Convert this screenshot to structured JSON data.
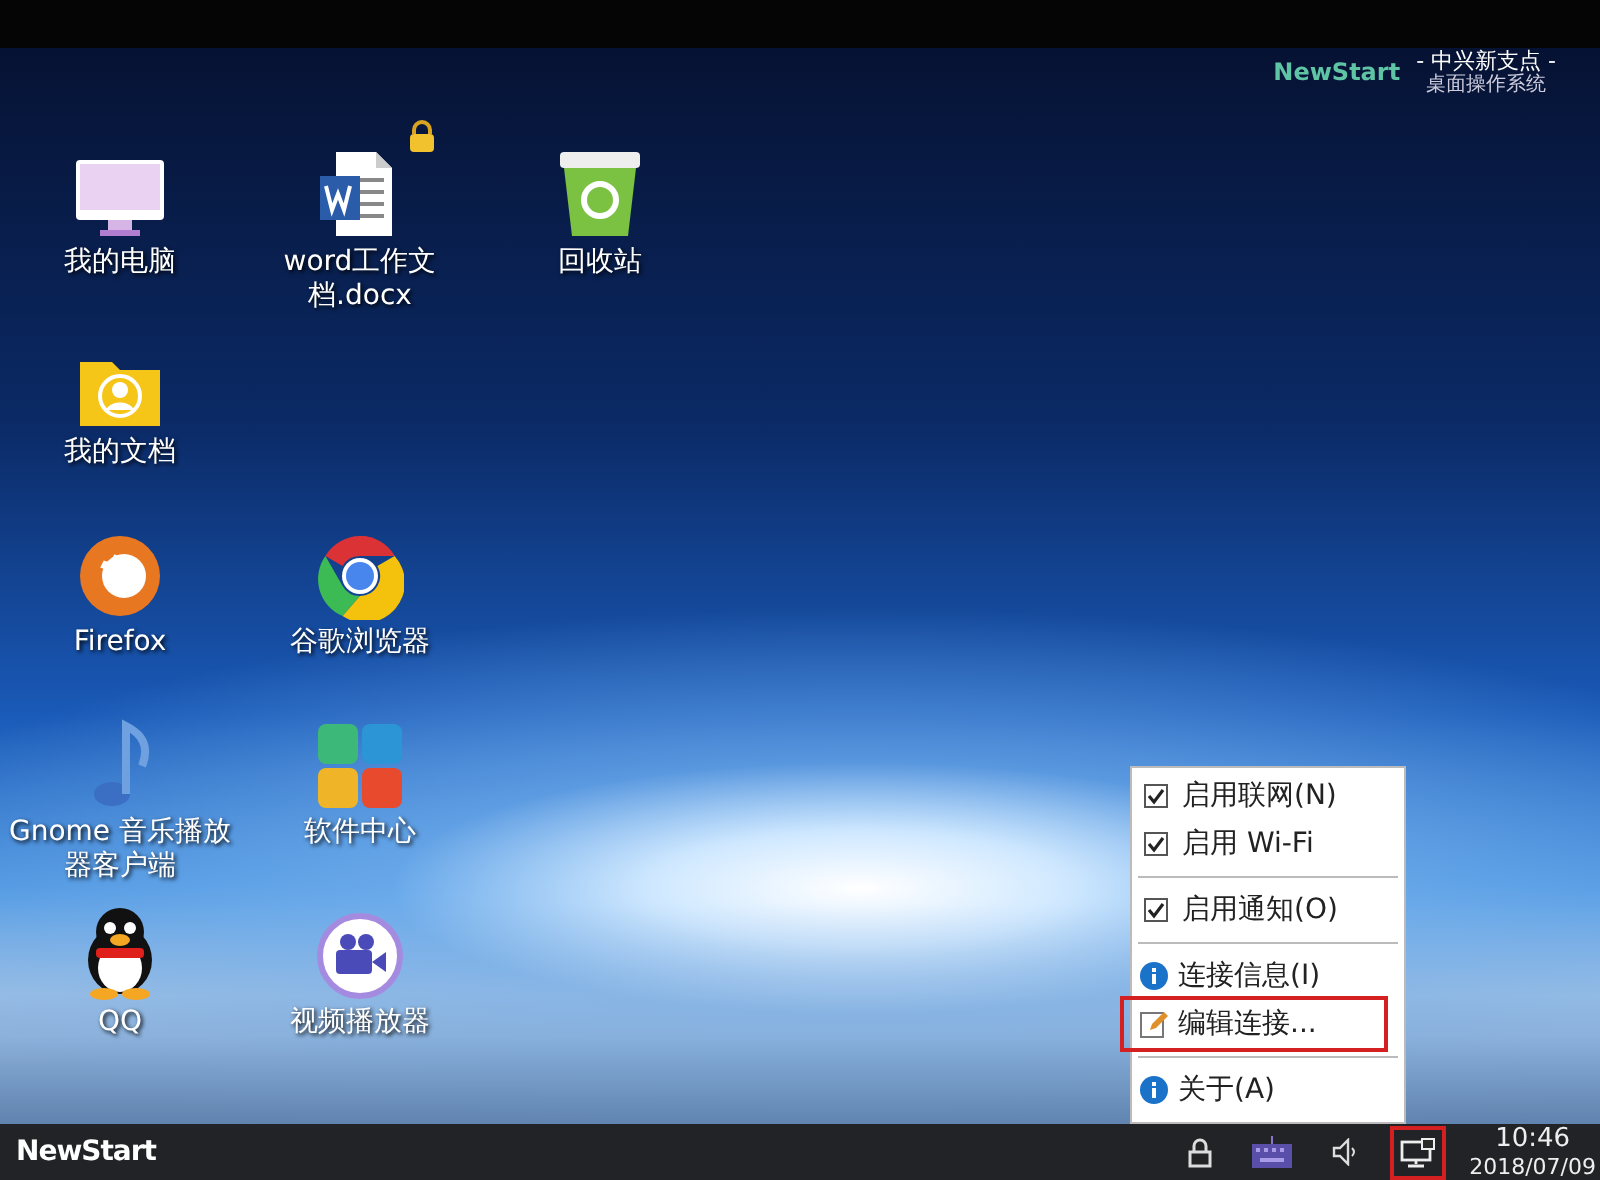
{
  "top_logo": {
    "brand": "NewStart",
    "title": "- 中兴新支点 -",
    "subtitle": "桌面操作系统"
  },
  "desktop": {
    "rows": [
      [
        {
          "kind": "computer",
          "label": "我的电脑"
        },
        {
          "kind": "document",
          "label": "word工作文档.docx",
          "locked": true
        },
        {
          "kind": "trash",
          "label": "回收站"
        }
      ],
      [
        {
          "kind": "folder",
          "label": "我的文档"
        }
      ],
      [
        {
          "kind": "firefox",
          "label": "Firefox"
        },
        {
          "kind": "chrome",
          "label": "谷歌浏览器"
        }
      ],
      [
        {
          "kind": "music",
          "label": "Gnome 音乐播放器客户端"
        },
        {
          "kind": "apps",
          "label": "软件中心"
        }
      ],
      [
        {
          "kind": "penguin",
          "label": "QQ"
        },
        {
          "kind": "video",
          "label": "视频播放器"
        }
      ]
    ]
  },
  "menu": {
    "items": [
      {
        "kind": "check",
        "label": "启用联网(N)",
        "checked": true,
        "highlighted": false
      },
      {
        "kind": "check",
        "label": "启用 Wi-Fi",
        "checked": true,
        "highlighted": false
      },
      {
        "kind": "separator"
      },
      {
        "kind": "check",
        "label": "启用通知(O)",
        "checked": true,
        "highlighted": false
      },
      {
        "kind": "separator"
      },
      {
        "kind": "info",
        "label": "连接信息(I)",
        "highlighted": false
      },
      {
        "kind": "edit",
        "label": "编辑连接...",
        "highlighted": true
      },
      {
        "kind": "separator"
      },
      {
        "kind": "info",
        "label": "关于(A)",
        "highlighted": false
      }
    ]
  },
  "taskbar": {
    "logo": "NewStart",
    "tray": [
      {
        "kind": "lock",
        "highlighted": false
      },
      {
        "kind": "keyboard",
        "highlighted": false
      },
      {
        "kind": "speaker",
        "highlighted": false
      },
      {
        "kind": "network",
        "highlighted": true
      }
    ],
    "time": "10:46",
    "date": "2018/07/09"
  }
}
